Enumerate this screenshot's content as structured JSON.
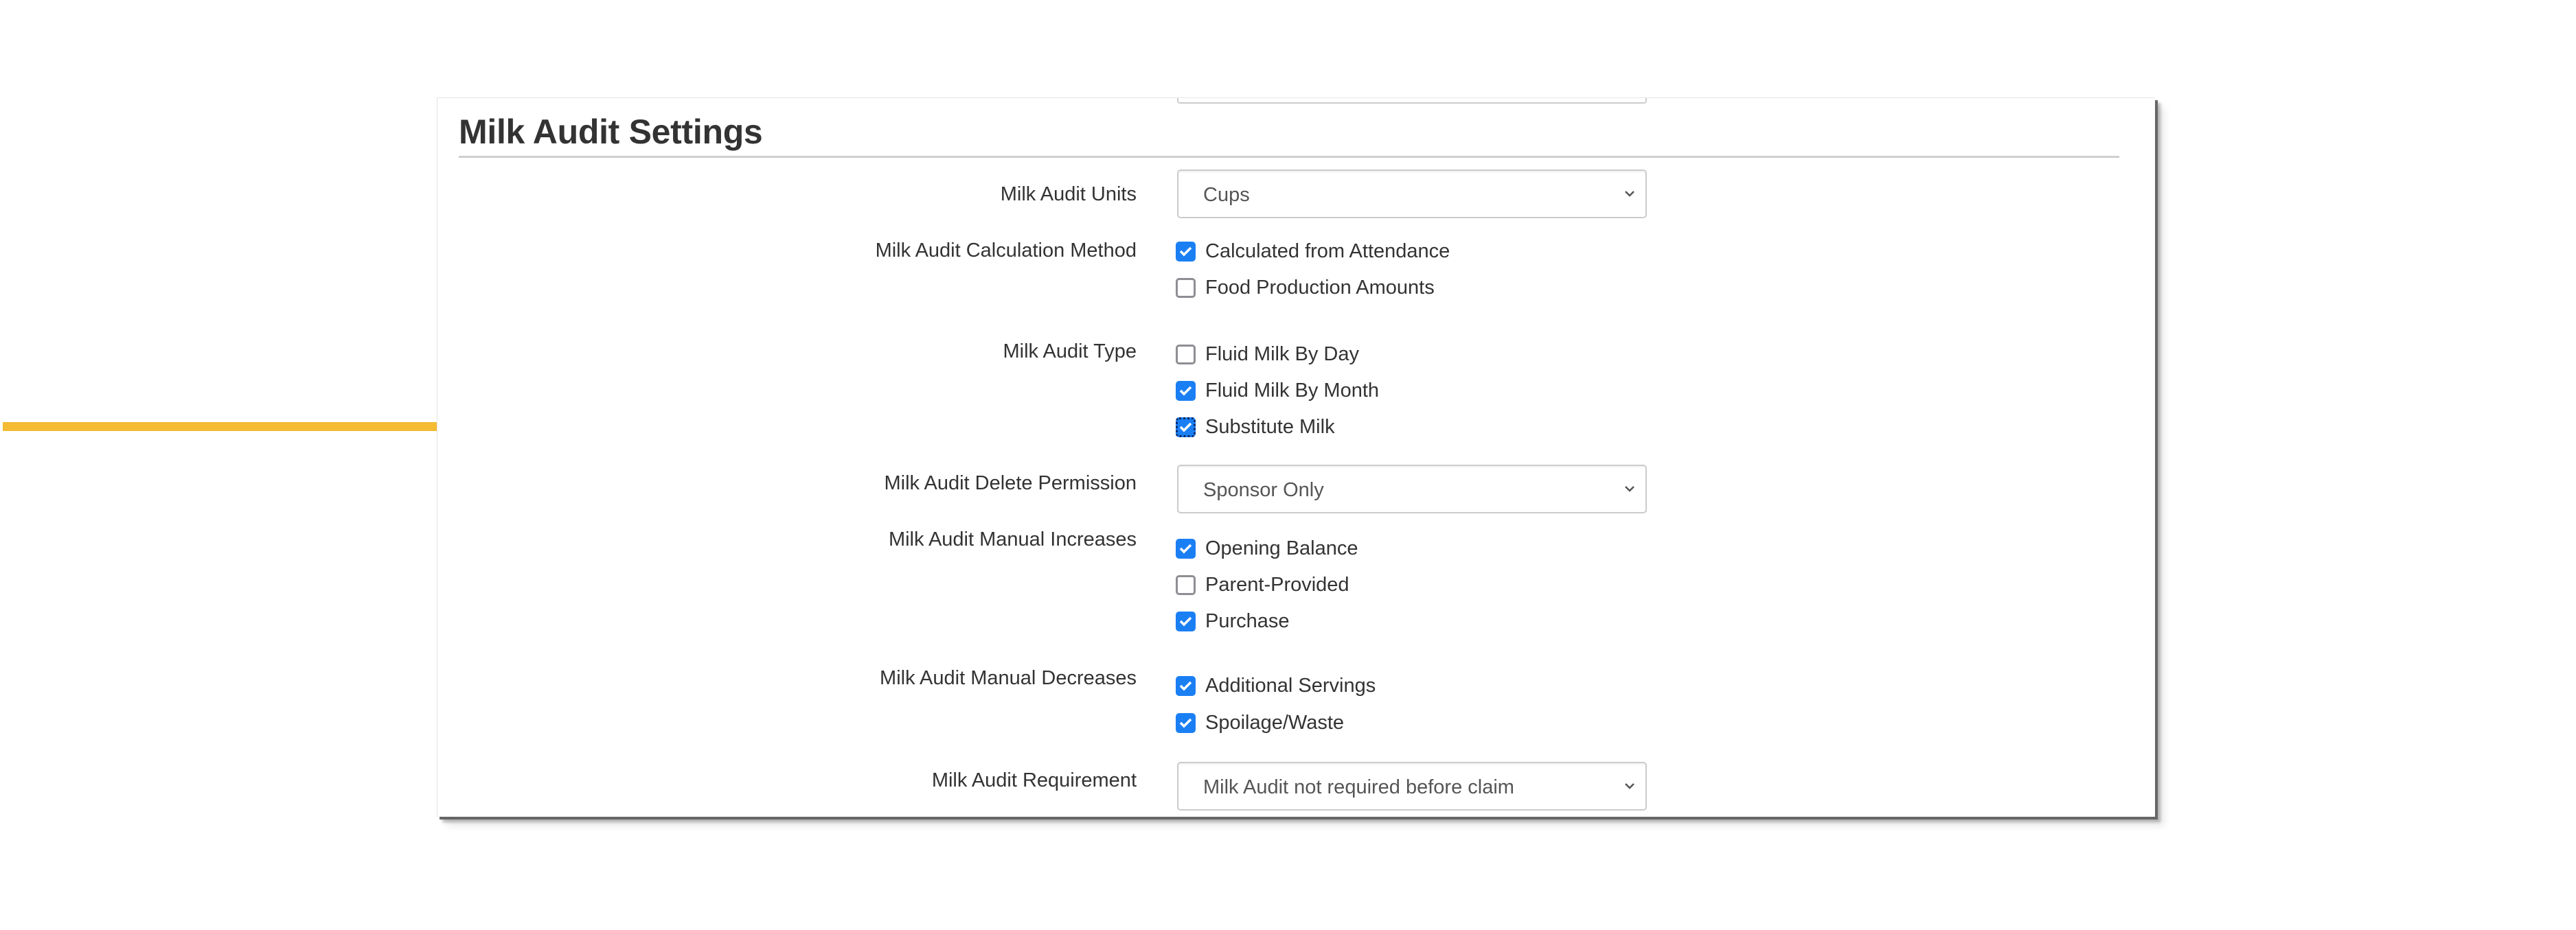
{
  "section": {
    "title": "Milk Audit Settings"
  },
  "fields": {
    "units": {
      "label": "Milk Audit Units",
      "value": "Cups"
    },
    "calculation_method": {
      "label": "Milk Audit Calculation Method",
      "options": [
        {
          "label": "Calculated from Attendance",
          "checked": true
        },
        {
          "label": "Food Production Amounts",
          "checked": false
        }
      ]
    },
    "type": {
      "label": "Milk Audit Type",
      "options": [
        {
          "label": "Fluid Milk By Day",
          "checked": false
        },
        {
          "label": "Fluid Milk By Month",
          "checked": true
        },
        {
          "label": "Substitute Milk",
          "checked": true,
          "focused": true
        }
      ]
    },
    "delete_permission": {
      "label": "Milk Audit Delete Permission",
      "value": "Sponsor Only"
    },
    "manual_increases": {
      "label": "Milk Audit Manual Increases",
      "options": [
        {
          "label": "Opening Balance",
          "checked": true
        },
        {
          "label": "Parent-Provided",
          "checked": false
        },
        {
          "label": "Purchase",
          "checked": true
        }
      ]
    },
    "manual_decreases": {
      "label": "Milk Audit Manual Decreases",
      "options": [
        {
          "label": "Additional Servings",
          "checked": true
        },
        {
          "label": "Spoilage/Waste",
          "checked": true
        }
      ]
    },
    "requirement": {
      "label": "Milk Audit Requirement",
      "value": "Milk Audit not required before claim"
    }
  },
  "annotation": {
    "icon": "arrow-right-icon",
    "points_to": "Substitute Milk",
    "color": "#F4BB33"
  },
  "colors": {
    "checkbox_checked": "#1B7FF4",
    "checkbox_unchecked_border": "#8E8E93",
    "label_text": "#333333",
    "select_text": "#555555"
  }
}
